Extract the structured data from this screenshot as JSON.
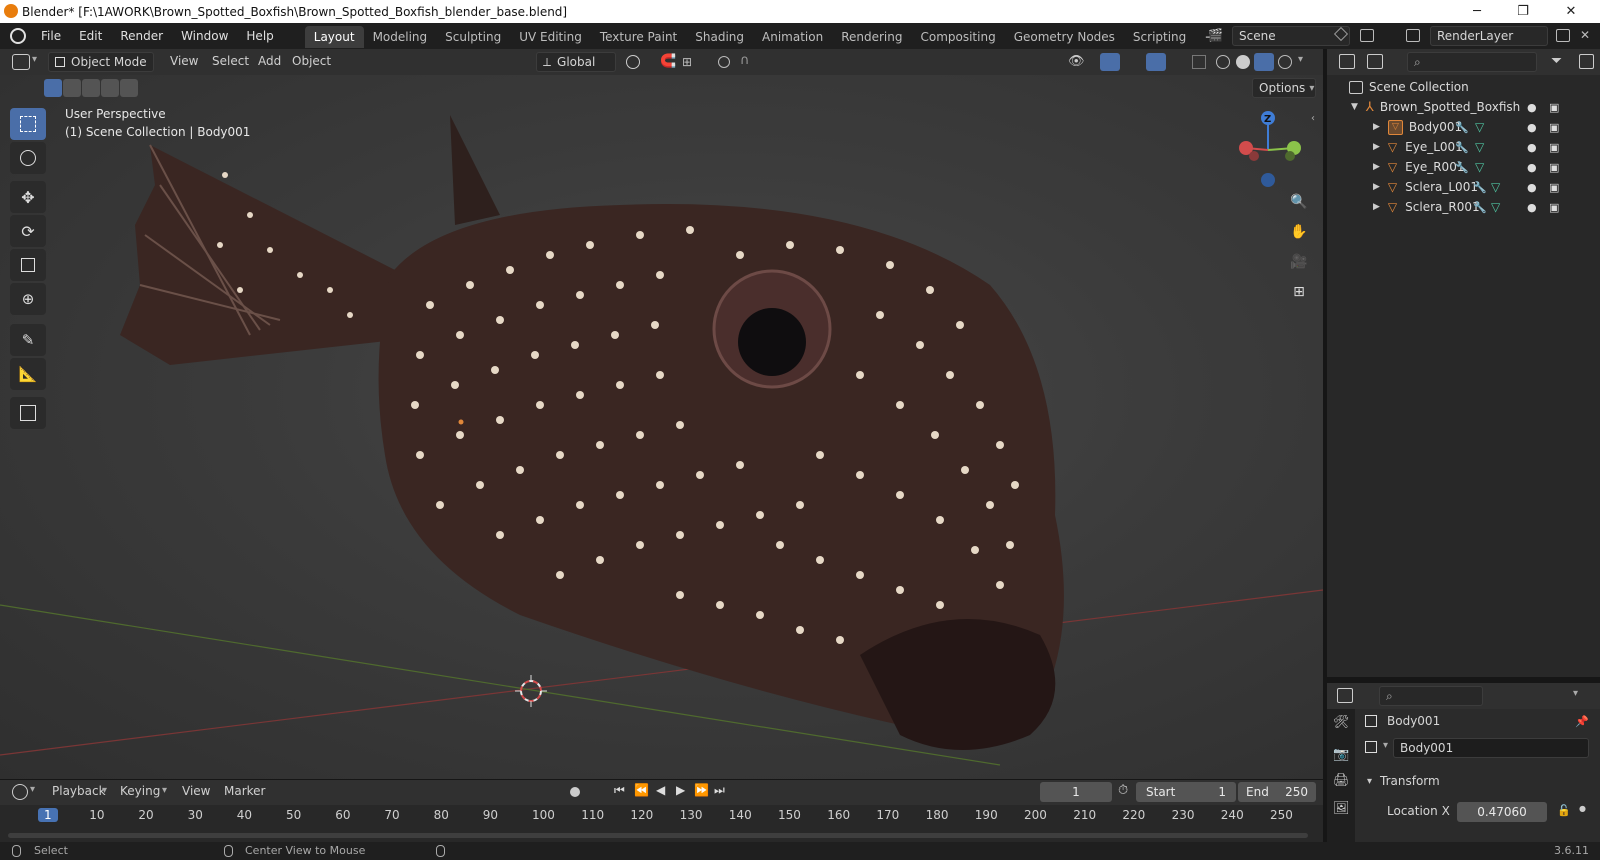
{
  "titlebar": {
    "title": "Blender* [F:\\1AWORK\\Brown_Spotted_Boxfish\\Brown_Spotted_Boxfish_blender_base.blend]",
    "minimize": "─",
    "restore": "❐",
    "close": "✕"
  },
  "menu": [
    "File",
    "Edit",
    "Render",
    "Window",
    "Help"
  ],
  "workspaces": [
    "Layout",
    "Modeling",
    "Sculpting",
    "UV Editing",
    "Texture Paint",
    "Shading",
    "Animation",
    "Rendering",
    "Compositing",
    "Geometry Nodes",
    "Scripting"
  ],
  "workspace_add": "+",
  "scene": {
    "name": "Scene",
    "view_layer": "RenderLayer"
  },
  "viewport_header": {
    "mode": "Object Mode",
    "menus": [
      "View",
      "Select",
      "Add",
      "Object"
    ],
    "orientation": "Global"
  },
  "viewport": {
    "perspective": "User Perspective",
    "collection_info": "(1) Scene Collection | Body001",
    "options": "Options",
    "gizmo_z": "Z"
  },
  "outliner": {
    "root": "Scene Collection",
    "collection": "Brown_Spotted_Boxfish",
    "objects": [
      "Body001",
      "Eye_L001",
      "Eye_R001",
      "Sclera_L001",
      "Sclera_R001"
    ]
  },
  "properties": {
    "object_name": "Body001",
    "datablock": "Body001",
    "panel": "Transform",
    "location_x_label": "Location X",
    "location_x_value": "0.47060"
  },
  "timeline": {
    "menus": [
      "Playback",
      "Keying",
      "View",
      "Marker"
    ],
    "current_frame": "1",
    "start_label": "Start",
    "start": "1",
    "end_label": "End",
    "end": "250",
    "ruler": [
      "1",
      "10",
      "20",
      "30",
      "40",
      "50",
      "60",
      "70",
      "80",
      "90",
      "100",
      "110",
      "120",
      "130",
      "140",
      "150",
      "160",
      "170",
      "180",
      "190",
      "200",
      "210",
      "220",
      "230",
      "240",
      "250"
    ]
  },
  "statusbar": {
    "left_hint": "Select",
    "mid_hint": "Center View to Mouse",
    "version": "3.6.11"
  },
  "colors": {
    "accent": "#4a6ea8",
    "active_frame": "#4772b3",
    "x_axis": "#d24c4c",
    "y_axis": "#8bc34a",
    "z_axis": "#3f7dd6",
    "object_orange": "#e0873a",
    "fish_body": "#3a2622"
  }
}
